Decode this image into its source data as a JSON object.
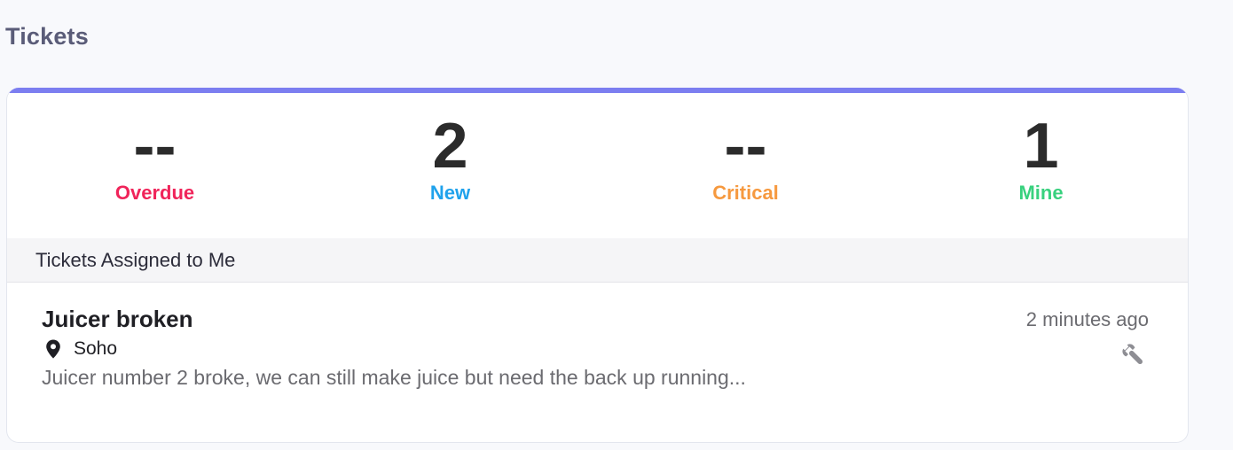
{
  "page": {
    "title": "Tickets"
  },
  "stats": [
    {
      "value": "--",
      "label": "Overdue",
      "color": "#f0245a"
    },
    {
      "value": "2",
      "label": "New",
      "color": "#1fa2ec"
    },
    {
      "value": "--",
      "label": "Critical",
      "color": "#f6993f"
    },
    {
      "value": "1",
      "label": "Mine",
      "color": "#38d17e"
    }
  ],
  "section": {
    "title": "Tickets Assigned to Me"
  },
  "tickets": [
    {
      "title": "Juicer broken",
      "location": "Soho",
      "location_icon": "map-pin-icon",
      "description": "Juicer number 2 broke, we can still make juice but need the back up running...",
      "time": "2 minutes ago",
      "category_icon": "wrench-icon"
    }
  ],
  "colors": {
    "accent": "#7c7ef0",
    "background": "#f8f9fc"
  }
}
